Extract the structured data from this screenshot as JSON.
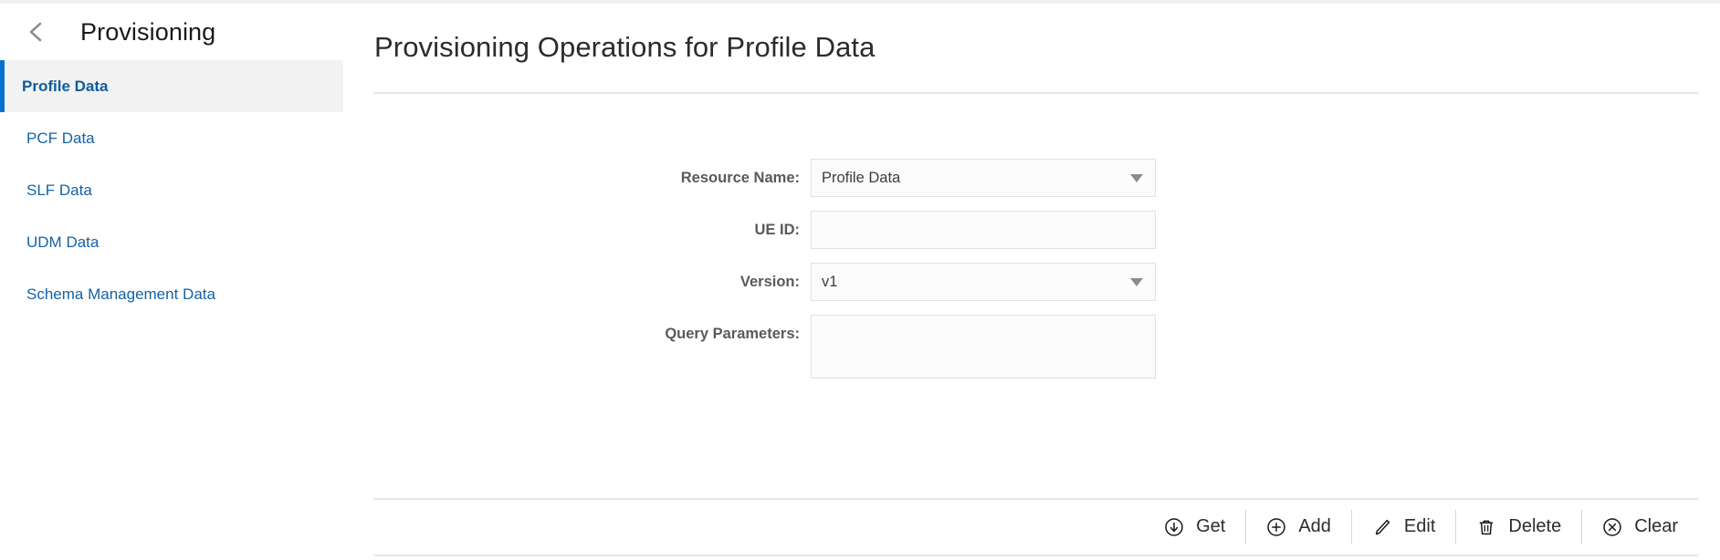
{
  "panel": {
    "back_icon": "chevron-left-icon",
    "title": "Provisioning",
    "nav": [
      {
        "label": "Profile Data",
        "active": true
      },
      {
        "label": "PCF Data",
        "active": false
      },
      {
        "label": "SLF Data",
        "active": false
      },
      {
        "label": "UDM Data",
        "active": false
      },
      {
        "label": "Schema Management Data",
        "active": false
      }
    ]
  },
  "main": {
    "title": "Provisioning Operations for Profile Data",
    "form": {
      "resource_name": {
        "label": "Resource Name:",
        "value": "Profile Data",
        "placeholder": "",
        "type": "select",
        "icon": "chevron-down-icon"
      },
      "ue_id": {
        "label": "UE ID:",
        "value": "",
        "placeholder": "",
        "type": "text"
      },
      "version": {
        "label": "Version:",
        "value": "v1",
        "placeholder": "",
        "type": "select",
        "icon": "chevron-down-icon"
      },
      "query_parameters": {
        "label": "Query Parameters:",
        "value": "",
        "placeholder": "",
        "type": "textarea"
      }
    },
    "actions": [
      {
        "label": "Get",
        "icon": "circle-arrow-down-icon"
      },
      {
        "label": "Add",
        "icon": "circle-plus-icon"
      },
      {
        "label": "Edit",
        "icon": "pencil-icon"
      },
      {
        "label": "Delete",
        "icon": "trash-icon"
      },
      {
        "label": "Clear",
        "icon": "circle-x-icon"
      }
    ]
  },
  "colors": {
    "accent_blue": "#0572ce",
    "link_blue": "#1462a6",
    "active_bg": "#f2f2f2",
    "label_gray": "#5a5a5a",
    "rule_gray": "#e6e6e6",
    "field_bg": "#fbfbfb",
    "field_border": "#e2e2e2"
  }
}
